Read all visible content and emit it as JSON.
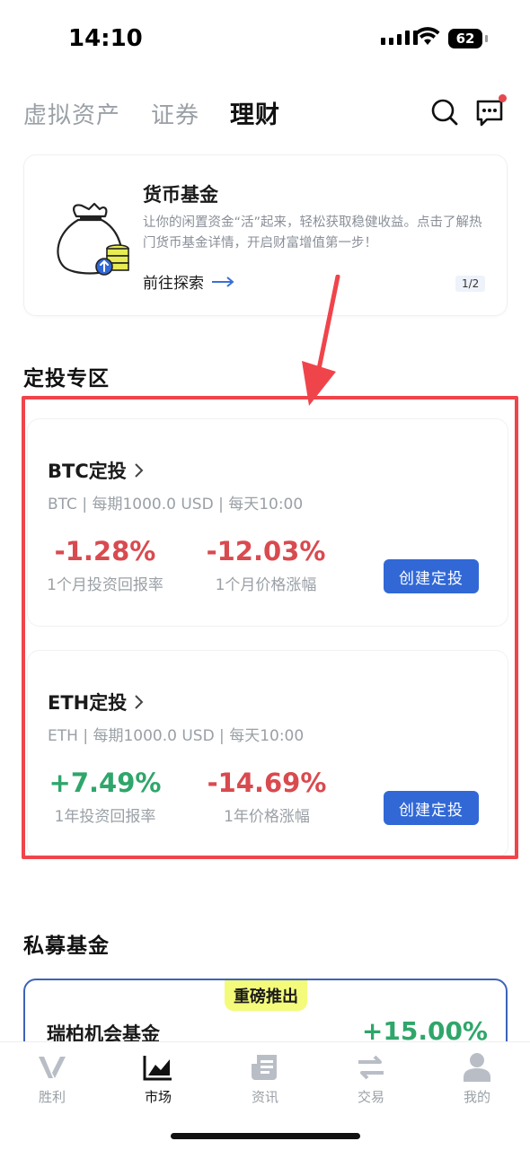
{
  "status": {
    "time": "14:10",
    "battery": "62"
  },
  "header": {
    "tabs": [
      {
        "label": "虚拟资产",
        "active": false
      },
      {
        "label": "证券",
        "active": false
      },
      {
        "label": "理财",
        "active": true
      }
    ],
    "icons": [
      "search-icon",
      "message-icon"
    ]
  },
  "fund_banner": {
    "title": "货币基金",
    "description": "让你的闲置资金“活”起来，轻松获取稳健收益。点击了解热门货币基金详情，开启财富增值第一步！",
    "link_label": "前往探索",
    "pager": "1/2"
  },
  "dca": {
    "section_title": "定投专区",
    "plans": [
      {
        "name": "BTC定投",
        "meta": "BTC | 每期1000.0 USD | 每天10:00",
        "return_value": "-1.28%",
        "return_label": "1个月投资回报率",
        "price_value": "-12.03%",
        "price_label": "1个月价格涨幅",
        "button": "创建定投"
      },
      {
        "name": "ETH定投",
        "meta": "ETH | 每期1000.0 USD | 每天10:00",
        "return_value": "+7.49%",
        "return_label": "1年投资回报率",
        "price_value": "-14.69%",
        "price_label": "1年价格涨幅",
        "button": "创建定投"
      }
    ]
  },
  "private_fund": {
    "section_title": "私募基金",
    "badge": "重磅推出",
    "name": "瑞柏机会基金",
    "value": "+15.00%"
  },
  "bottom_nav": [
    {
      "label": "胜利",
      "icon": "victory-logo-icon",
      "active": false
    },
    {
      "label": "市场",
      "icon": "market-chart-icon",
      "active": true
    },
    {
      "label": "资讯",
      "icon": "news-icon",
      "active": false
    },
    {
      "label": "交易",
      "icon": "swap-icon",
      "active": false
    },
    {
      "label": "我的",
      "icon": "profile-icon",
      "active": false
    }
  ],
  "colors": {
    "accent": "#3168d6",
    "negative": "#d94a4f",
    "positive": "#2fa66a",
    "annotation": "#f0444b",
    "badge": "#f4fb7a"
  }
}
